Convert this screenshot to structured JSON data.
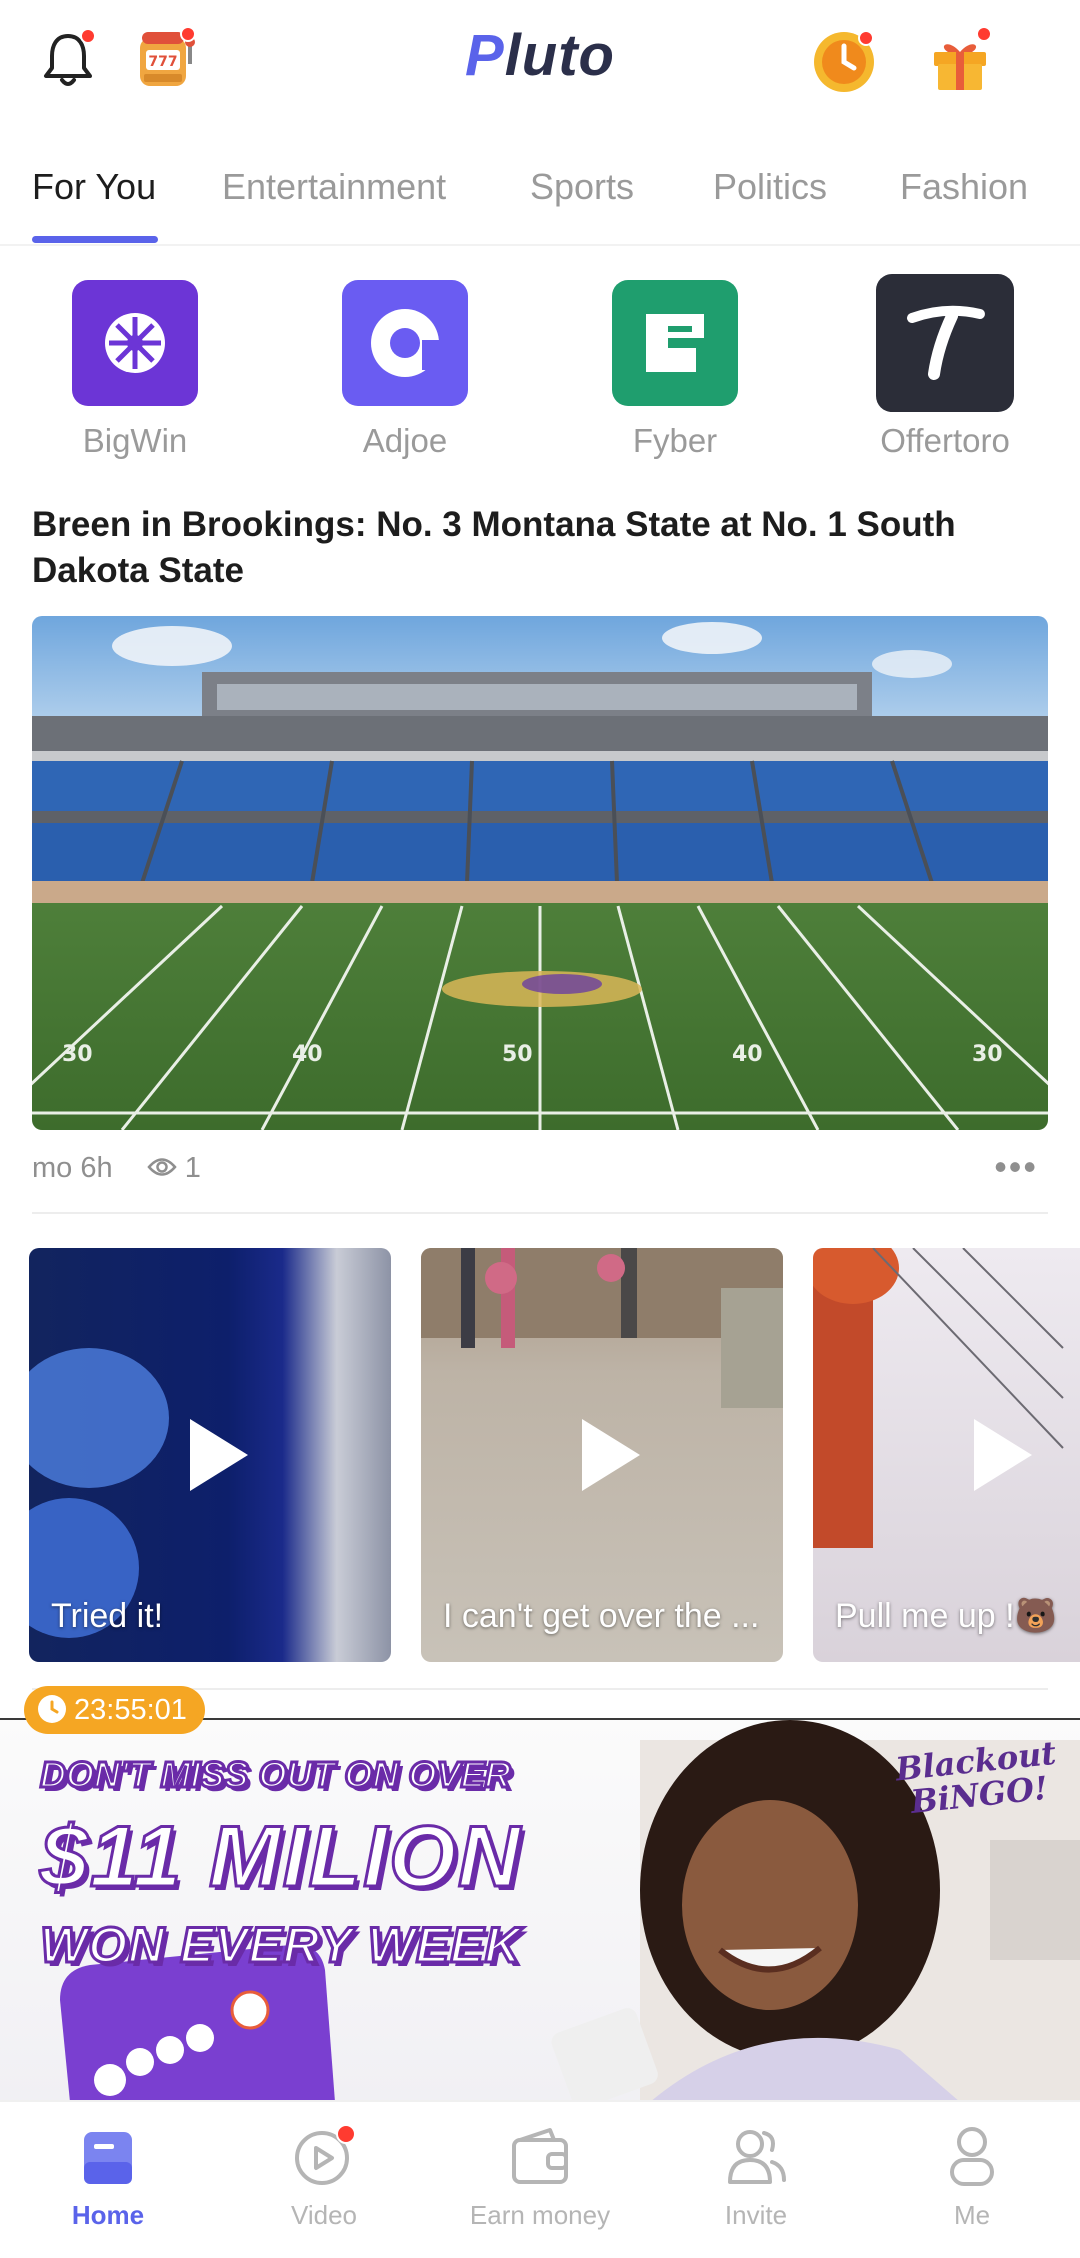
{
  "header": {
    "logo": "Pluto",
    "icons": [
      "bell-icon",
      "slot-machine-icon",
      "coin-timer-icon",
      "gift-icon"
    ],
    "colors": {
      "brand": "#5a63ea",
      "badge": "#ff3b30"
    }
  },
  "tabs": [
    "For You",
    "Entertainment",
    "Sports",
    "Politics",
    "Fashion"
  ],
  "partners": [
    {
      "label": "BigWin",
      "color": "#6c35d6"
    },
    {
      "label": "Adjoe",
      "color": "#6a5cf2"
    },
    {
      "label": "Fyber",
      "color": "#1f9e6e"
    },
    {
      "label": "Offertoro",
      "color": "#2b2d38"
    }
  ],
  "article": {
    "title": "Breen in Brookings: No. 3 Montana State at No. 1 South Dakota State",
    "image": "football-stadium",
    "time": "mo 6h",
    "views": "1"
  },
  "videos": [
    {
      "caption": "Tried it!"
    },
    {
      "caption": "I can't get over the ..."
    },
    {
      "caption": "Pull me up !🐻"
    }
  ],
  "ad": {
    "timer": "23:55:01",
    "line1": "DON'T MISS OUT ON OVER",
    "line2": "$11 MILION",
    "line3": "WON EVERY WEEK",
    "brand_line1": "Blackout",
    "brand_line2": "BiNGO!"
  },
  "bottom_nav": [
    "Home",
    "Video",
    "Earn money",
    "Invite",
    "Me"
  ]
}
